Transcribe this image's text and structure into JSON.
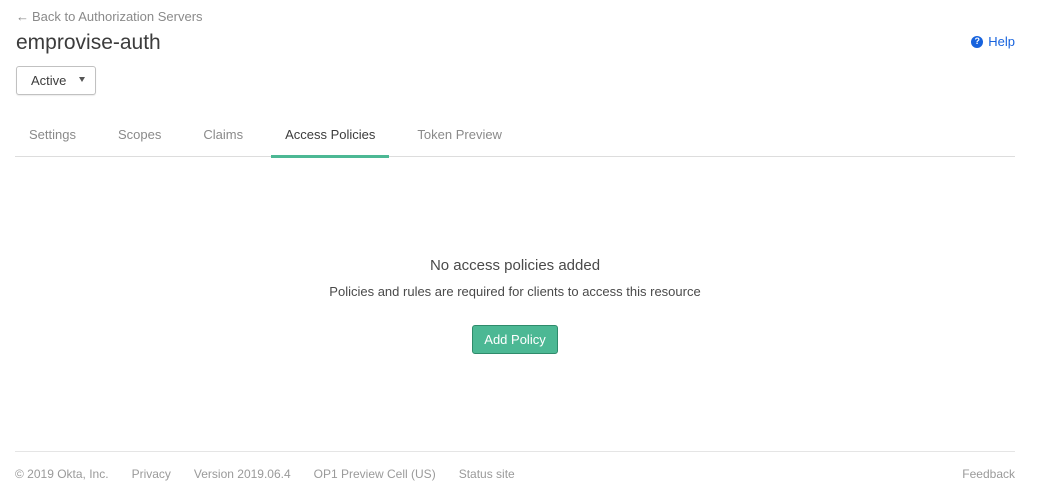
{
  "header": {
    "back_arrow": "←",
    "back_label": "Back to Authorization Servers",
    "title": "emprovise-auth",
    "help_icon_glyph": "?",
    "help_label": "Help"
  },
  "status_select": {
    "value": "Active"
  },
  "tabs": [
    {
      "label": "Settings",
      "active": false
    },
    {
      "label": "Scopes",
      "active": false
    },
    {
      "label": "Claims",
      "active": false
    },
    {
      "label": "Access Policies",
      "active": true
    },
    {
      "label": "Token Preview",
      "active": false
    }
  ],
  "empty_state": {
    "title": "No access policies added",
    "description": "Policies and rules are required for clients to access this resource",
    "button_label": "Add Policy"
  },
  "footer": {
    "copyright": "© 2019 Okta, Inc.",
    "privacy": "Privacy",
    "version": "Version 2019.06.4",
    "cell": "OP1 Preview Cell (US)",
    "status_site": "Status site",
    "feedback": "Feedback"
  },
  "colors": {
    "accent": "#4cb894",
    "link": "#1662dd",
    "muted_text": "#8a8a8a"
  }
}
